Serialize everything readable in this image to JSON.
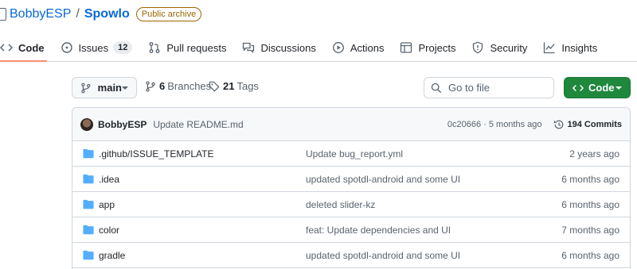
{
  "repo": {
    "owner": "BobbyESP",
    "separator": "/",
    "name": "Spowlo",
    "visibility": "Public archive"
  },
  "tabs": [
    {
      "label": "Code",
      "icon": "code-icon"
    },
    {
      "label": "Issues",
      "icon": "issue-icon",
      "count": "12"
    },
    {
      "label": "Pull requests",
      "icon": "pull-request-icon"
    },
    {
      "label": "Discussions",
      "icon": "discussions-icon"
    },
    {
      "label": "Actions",
      "icon": "play-icon"
    },
    {
      "label": "Projects",
      "icon": "table-icon"
    },
    {
      "label": "Security",
      "icon": "shield-icon"
    },
    {
      "label": "Insights",
      "icon": "graph-icon"
    }
  ],
  "toolbar": {
    "branch": "main",
    "branches_count": "6",
    "branches_label": "Branches",
    "tags_count": "21",
    "tags_label": "Tags",
    "search_placeholder": "Go to file",
    "code_button": "Code"
  },
  "latest_commit": {
    "author": "BobbyESP",
    "message": "Update README.md",
    "meta": "0c20666 · 5 months ago",
    "commits": "194 Commits"
  },
  "files": [
    {
      "name": ".github/ISSUE_TEMPLATE",
      "message": "Update bug_report.yml",
      "date": "2 years ago"
    },
    {
      "name": ".idea",
      "message": "updated spotdl-android and some UI",
      "date": "6 months ago"
    },
    {
      "name": "app",
      "message": "deleted slider-kz",
      "date": "6 months ago"
    },
    {
      "name": "color",
      "message": "feat: Update dependencies and UI",
      "date": "7 months ago"
    },
    {
      "name": "gradle",
      "message": "updated spotdl-android and some UI",
      "date": "6 months ago"
    }
  ],
  "colors": {
    "link": "#0969da",
    "folder": "#54aeff",
    "primary_button": "#1f883d",
    "selected_tab_underline": "#fd8c73",
    "archive_badge": "#9a6700"
  }
}
